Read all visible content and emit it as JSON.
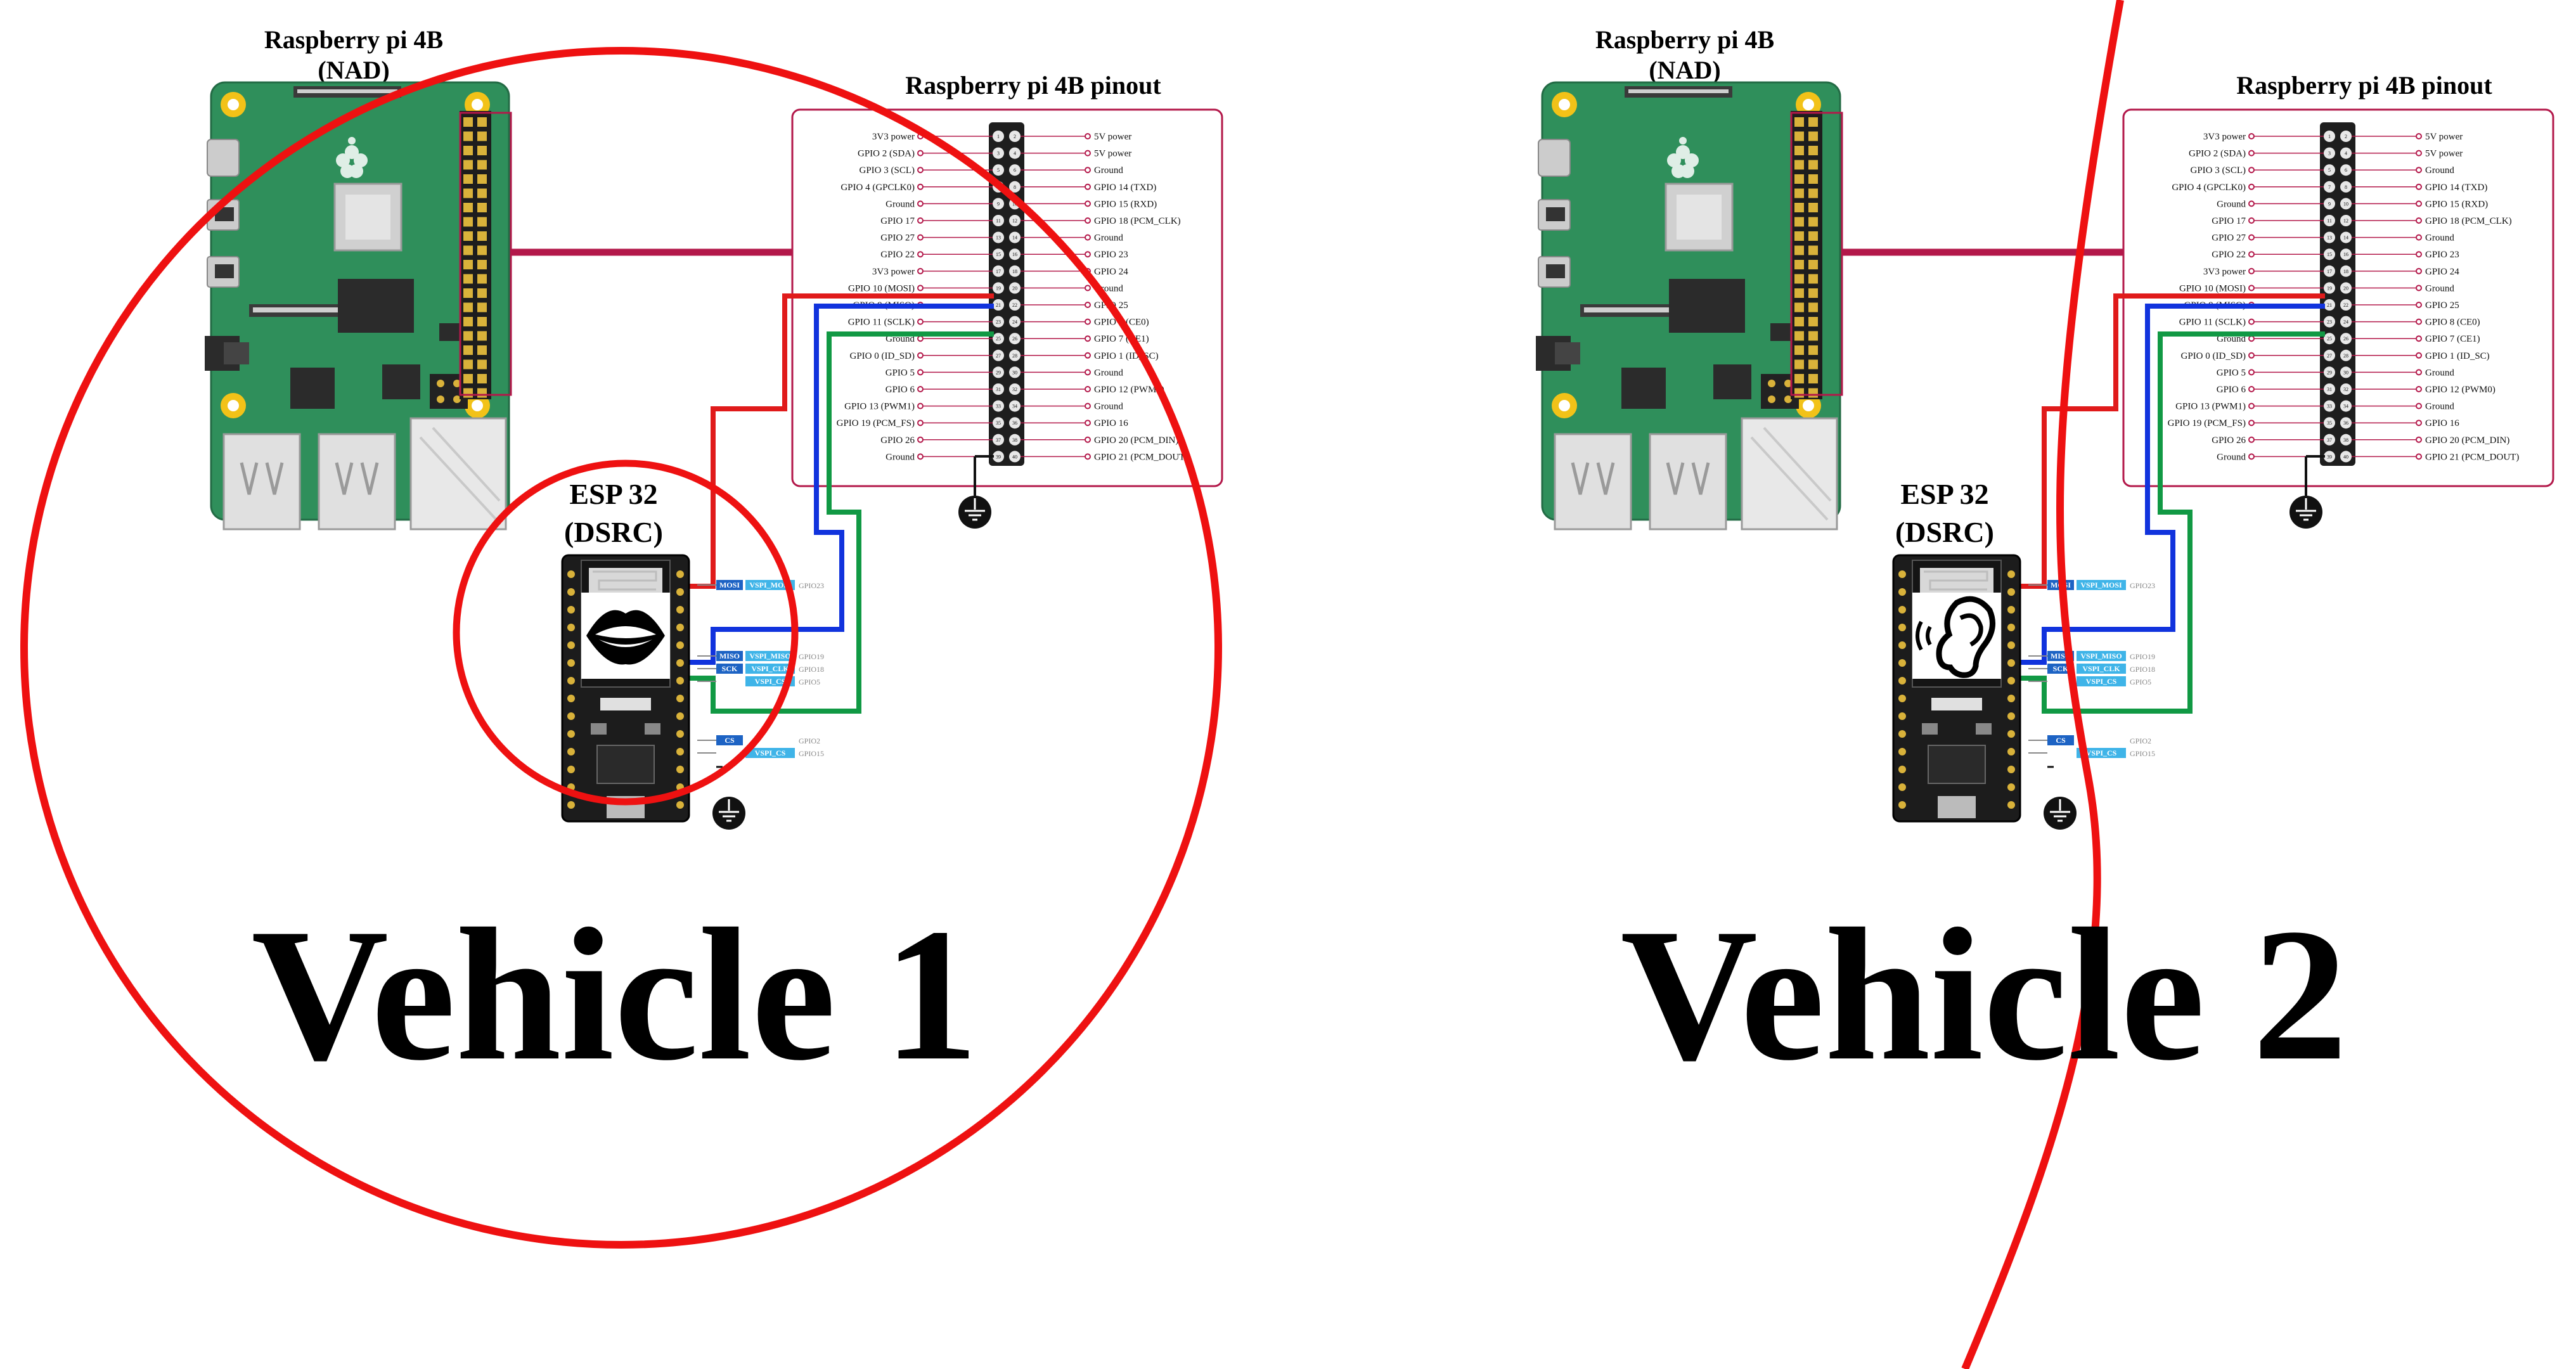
{
  "vehicles": [
    {
      "pi_title_line1": "Raspberry pi 4B",
      "pi_title_line2": "(NAD)",
      "pinout_title": "Raspberry pi 4B pinout",
      "esp_title_line1": "ESP 32",
      "esp_title_line2": "(DSRC)",
      "esp_icon": "mouth-icon",
      "vehicle_label": "Vehicle 1"
    },
    {
      "pi_title_line1": "Raspberry pi 4B",
      "pi_title_line2": "(NAD)",
      "pinout_title": "Raspberry pi 4B pinout",
      "esp_title_line1": "ESP 32",
      "esp_title_line2": "(DSRC)",
      "esp_icon": "ear-icon",
      "vehicle_label": "Vehicle 2"
    }
  ],
  "pinout": {
    "left": [
      "3V3 power",
      "GPIO 2 (SDA)",
      "GPIO 3 (SCL)",
      "GPIO 4 (GPCLK0)",
      "Ground",
      "GPIO 17",
      "GPIO 27",
      "GPIO 22",
      "3V3 power",
      "GPIO 10 (MOSI)",
      "GPIO 9 (MISO)",
      "GPIO 11 (SCLK)",
      "Ground",
      "GPIO 0 (ID_SD)",
      "GPIO 5",
      "GPIO 6",
      "GPIO 13 (PWM1)",
      "GPIO 19 (PCM_FS)",
      "GPIO 26",
      "Ground"
    ],
    "right": [
      "5V power",
      "5V power",
      "Ground",
      "GPIO 14 (TXD)",
      "GPIO 15 (RXD)",
      "GPIO 18 (PCM_CLK)",
      "Ground",
      "GPIO 23",
      "GPIO 24",
      "Ground",
      "GPIO 25",
      "GPIO 8 (CE0)",
      "GPIO 7 (CE1)",
      "GPIO 1 (ID_SC)",
      "Ground",
      "GPIO 12 (PWM0)",
      "Ground",
      "GPIO 16",
      "GPIO 20 (PCM_DIN)",
      "GPIO 21 (PCM_DOUT)"
    ]
  },
  "esp_pin_labels": {
    "group1": [
      "MOSI",
      "VSPI_MOSI",
      "GPIO23"
    ],
    "group2": [
      [
        "MISO",
        "VSPI_MISO",
        "GPIO19"
      ],
      [
        "SCK",
        "VSPI_CLK",
        "GPIO18"
      ],
      [
        "",
        "VSPI_CS",
        "GPIO5"
      ]
    ],
    "group3": [
      [
        "CS",
        "",
        "GPIO2"
      ],
      [
        "",
        "VSPI_CS",
        "GPIO15"
      ]
    ]
  },
  "colors": {
    "range_circle": "#ee1111",
    "wire_mosi": "#e01b1b",
    "wire_miso": "#1133dd",
    "wire_sclk": "#119944",
    "board_green": "#2f8f5b",
    "ribbon": "#b3184a",
    "esp_label_blue": "#1d63c4",
    "esp_label_cyan": "#3fb4e8"
  }
}
